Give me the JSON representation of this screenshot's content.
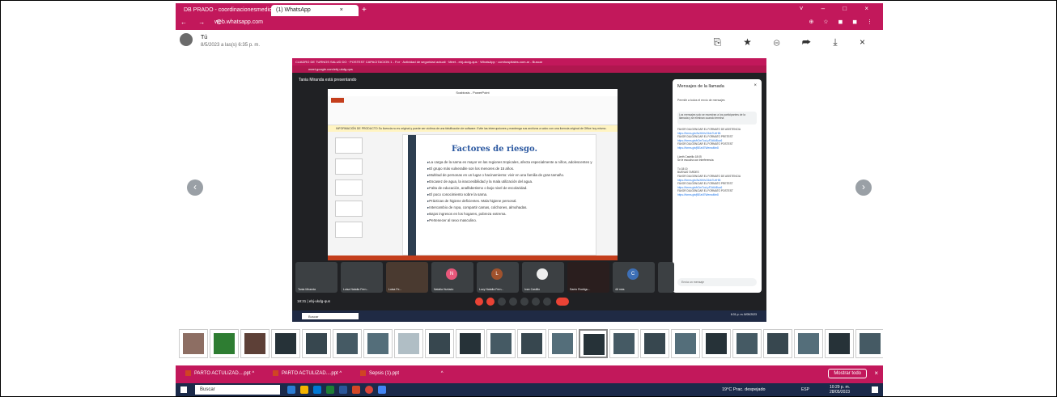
{
  "browser": {
    "tabs": [
      {
        "title": "DB PRADO - coordinacionesmedic",
        "close": "×"
      },
      {
        "title": "(1) WhatsApp",
        "close": "×"
      }
    ],
    "new_tab": "+",
    "window_controls": "˅ – □ ×",
    "nav": "← → C",
    "url": "web.whatsapp.com",
    "extensions": "⊕ ☆ ◼ ◼ ⋮"
  },
  "viewer": {
    "sender": "Tú",
    "date": "8/5/2023 a las(s) 6:35 p. m.",
    "actions": "⎘ ★ ⊜ ➦ ⤓ ×",
    "prev": "‹",
    "next": "›"
  },
  "shared_image": {
    "tab_text": "CUADRO DE TURNOS SALUD DO  ·  POSTEST CAPACITACION 1 - For  ·  Actividad de seguridad actuali  ·  Meet - ebj-ukdg-qus  ·  WhatsApp  ·  ucmhospitales.com.ar - Buscar",
    "url": "meet.google.com/ebj-ukdg-qus",
    "presenting": "Tania Miranda está presentando",
    "ppt_title": "Scabiosis - PowerPoint",
    "warning": "INFORMACIÓN DE PRODUCTO   Su licencia no es original y puede ser víctima de una falsificación de software. Evite las interrupciones y mantenga sus archivos a salvo con una licencia original de Office hoy mismo.",
    "slide_title": "Factores de riesgo.",
    "bullets": [
      "La carga de la sarna es mayor en las regiones tropicales, afecta especialmente a niños, adolescentes y ancianos.",
      "El grupo más vulnerable son los menores de 15 años.",
      "Multitud de personas en un lugar o hacinamiento: vivir en una familia de gran tamaño.",
      "Escasez de agua, la inaccesibilidad y la mala utilización del agua.",
      "Falta de educación, analfabetismo o bajo nivel de escolaridad.",
      "El poco conocimiento sobre la sarna.",
      "Prácticas de higiene deficientes. Mala higiene personal.",
      "Intercambio de ropa, compartir camas, colchones, almohadas.",
      "Bajos ingresos en los hogares, pobreza extrema.",
      "Pertenecer al sexo masculino."
    ],
    "chat": {
      "title": "Mensajes de la llamada",
      "close": "×",
      "toggle": "Permitir a todos el envío de mensajes",
      "note": "Los mensajes solo se muestran a los participantes de la llamada y se eliminan cuando termina",
      "messages": [
        "FAVOR DILIGENCIAR EL FORMATO DE ASISTENCIA",
        "https://forms.gle/AsXbNvC6ds7UeH6t",
        "FAVOR DILIGENCIAR EL FORMATO PRETEST",
        "https://forms.gle/bDmTucLyF2d6dBuo6",
        "FAVOR DILIGENCIAR EL FORMATO POSTEST",
        "https://forms.gle/jBEaVEWemaMm8",
        "Lizeth Castrillo  18:05",
        "Se le escucha con interferencia",
        "Tú  18:10",
        "BUENAS TARDES",
        "FAVOR DILIGENCIAR EL FORMATO DE ASISTENCIA",
        "https://forms.gle/AsXbNvC6ds7UeH6t",
        "FAVOR DILIGENCIAR EL FORMATO PRETEST",
        "https://forms.gle/bDmTucLyF2d6dBuo6",
        "FAVOR DILIGENCIAR EL FORMATO POSTEST",
        "https://forms.gle/jBEaVEWemaMm8"
      ],
      "input_placeholder": "Envía un mensaje"
    },
    "participants": [
      {
        "name": "Tania Miranda",
        "initial": ""
      },
      {
        "name": "Luisa Natalia Fern...",
        "initial": ""
      },
      {
        "name": "Luisa Fe...",
        "initial": ""
      },
      {
        "name": "Natalia Hurtado",
        "initial": "N"
      },
      {
        "name": "Lucy Natalia Fern...",
        "initial": "L"
      },
      {
        "name": "Ivan Castillo",
        "initial": ""
      },
      {
        "name": "Santo Rodrigu...",
        "initial": ""
      },
      {
        "name": "46 más",
        "initial": "C"
      },
      {
        "name": "Tú",
        "initial": "C"
      }
    ],
    "meet_time": "18:31  |  ebj-ukdg-qus",
    "search": "Buscar",
    "clock": "6:31 p. m.  8/05/2023"
  },
  "downloads": [
    {
      "name": "PARTO ACTULIZAD....ppt",
      "chevron": "^"
    },
    {
      "name": "PARTO ACTULIZAD....ppt",
      "chevron": "^"
    },
    {
      "name": "Sepsis (1).ppt",
      "chevron": "^"
    }
  ],
  "show_all": "Mostrar todo",
  "dl_close": "×",
  "taskbar": {
    "search": "Buscar",
    "weather": "19°C Prac. despejado",
    "lang": "ESP",
    "time": "10:29 p. m.",
    "date": "28/05/2023"
  },
  "colors": {
    "chrome_accent": "#c2185b",
    "taskbar": "#1b2a4a",
    "slide_title": "#2b58a0"
  }
}
